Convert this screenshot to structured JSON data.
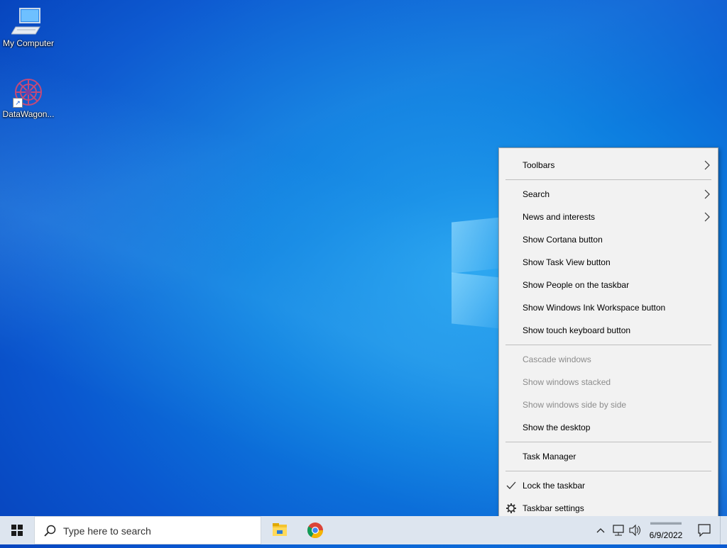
{
  "desktop": {
    "icons": [
      {
        "label": "My Computer"
      },
      {
        "label": "DataWagon..."
      }
    ]
  },
  "context_menu": {
    "items": [
      {
        "label": "Toolbars",
        "submenu": true
      },
      {
        "label": "Search",
        "submenu": true
      },
      {
        "label": "News and interests",
        "submenu": true
      },
      {
        "label": "Show Cortana button"
      },
      {
        "label": "Show Task View button"
      },
      {
        "label": "Show People on the taskbar"
      },
      {
        "label": "Show Windows Ink Workspace button"
      },
      {
        "label": "Show touch keyboard button"
      },
      {
        "label": "Cascade windows",
        "disabled": true
      },
      {
        "label": "Show windows stacked",
        "disabled": true
      },
      {
        "label": "Show windows side by side",
        "disabled": true
      },
      {
        "label": "Show the desktop"
      },
      {
        "label": "Task Manager"
      },
      {
        "label": "Lock the taskbar",
        "checked": true
      },
      {
        "label": "Taskbar settings",
        "icon": "gear-icon"
      }
    ]
  },
  "taskbar": {
    "search_placeholder": "Type here to search",
    "apps": [
      {
        "name": "file-explorer-icon"
      },
      {
        "name": "chrome-icon"
      }
    ],
    "clock": {
      "date": "6/9/2022"
    }
  },
  "colors": {
    "menu_bg": "#f2f2f2",
    "taskbar_bg": "#dde5ef",
    "disabled_text": "#8c8c8c",
    "desktop_blue": "#0a56cf"
  }
}
